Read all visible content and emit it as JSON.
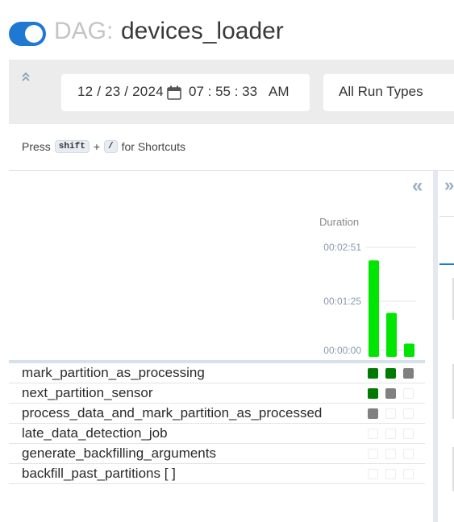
{
  "header": {
    "dag_prefix": "DAG:",
    "dag_name": "devices_loader",
    "toggle_on": true
  },
  "filters": {
    "date": "12 / 23 / 2024",
    "time": "07 : 55 : 33",
    "ampm": "AM",
    "run_type": "All Run Types"
  },
  "shortcuts": {
    "press": "Press",
    "key1": "shift",
    "plus": "+",
    "key2": "/",
    "suffix": "for Shortcuts"
  },
  "chart_data": {
    "type": "bar",
    "title": "Duration",
    "yticks": [
      "00:02:51",
      "00:01:25",
      "00:00:00"
    ],
    "ylim_seconds": [
      0,
      171
    ],
    "values_seconds": [
      160,
      73,
      22
    ],
    "bar_color": "#00e600"
  },
  "status_colors": {
    "success": "#007a00",
    "upstream_failed": "#808080",
    "none": "#ffffff"
  },
  "tasks": [
    {
      "name": "mark_partition_as_processing",
      "states": [
        "success",
        "success",
        "upstream_failed"
      ]
    },
    {
      "name": "next_partition_sensor",
      "states": [
        "success",
        "upstream_failed",
        "none"
      ]
    },
    {
      "name": "process_data_and_mark_partition_as_processed",
      "states": [
        "upstream_failed",
        "none",
        "none"
      ]
    },
    {
      "name": "late_data_detection_job",
      "states": [
        "none",
        "none",
        "none"
      ]
    },
    {
      "name": "generate_backfilling_arguments",
      "states": [
        "none",
        "none",
        "none"
      ]
    },
    {
      "name": "backfill_past_partitions [ ]",
      "states": [
        "none",
        "none",
        "none"
      ]
    }
  ]
}
